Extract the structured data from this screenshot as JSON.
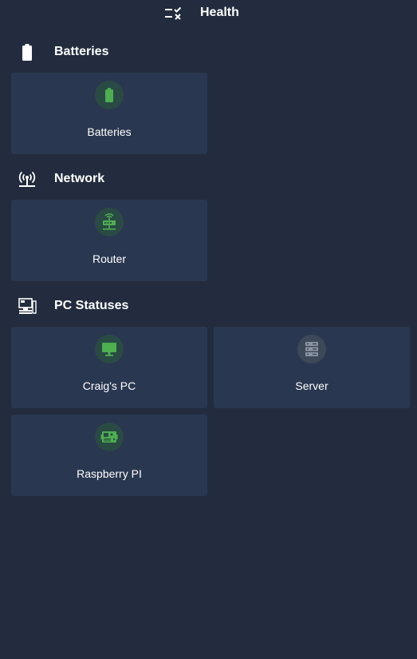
{
  "header": {
    "title": "Health",
    "icon": "list-check-icon"
  },
  "sections": [
    {
      "title": "Batteries",
      "icon": "battery-icon",
      "cards": [
        {
          "label": "Batteries",
          "icon": "battery-icon",
          "status_color": "#4caf50"
        }
      ]
    },
    {
      "title": "Network",
      "icon": "antenna-icon",
      "cards": [
        {
          "label": "Router",
          "icon": "router-icon",
          "status_color": "#4caf50"
        }
      ]
    },
    {
      "title": "PC Statuses",
      "icon": "computer-icon",
      "cards": [
        {
          "label": "Craig's PC",
          "icon": "monitor-icon",
          "status_color": "#4caf50"
        },
        {
          "label": "Server",
          "icon": "server-icon",
          "status_color": "#8a93a2"
        },
        {
          "label": "Raspberry PI",
          "icon": "circuit-board-icon",
          "status_color": "#4caf50"
        }
      ]
    }
  ],
  "colors": {
    "background": "#222c3e",
    "card": "#2a3750",
    "ok": "#4caf50",
    "unknown": "#8a93a2"
  }
}
